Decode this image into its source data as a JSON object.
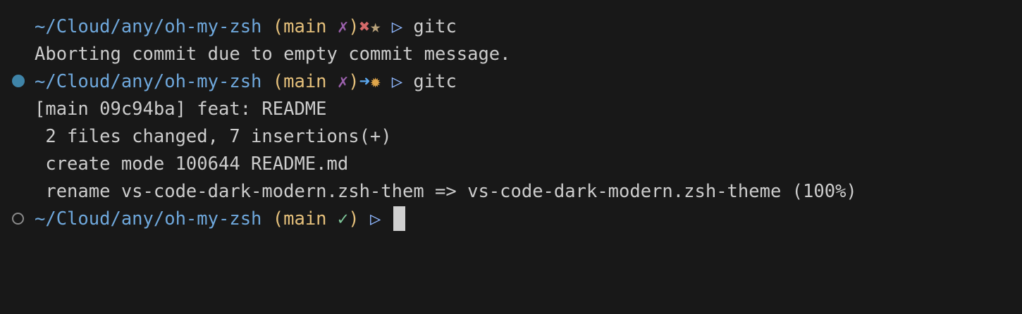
{
  "prompt": {
    "path": "~/Cloud/any/oh-my-zsh",
    "branch": "main",
    "dirty_mark": "✗",
    "clean_mark": "✓",
    "prompt_char": "▷"
  },
  "lines": [
    {
      "type": "prompt",
      "status": [
        "✖",
        "★"
      ],
      "command": "gitc"
    },
    {
      "type": "output",
      "text": "Aborting commit due to empty commit message."
    },
    {
      "type": "prompt",
      "status": [
        "➜",
        "✹"
      ],
      "command": "gitc"
    },
    {
      "type": "output",
      "text": "[main 09c94ba] feat: README"
    },
    {
      "type": "output",
      "text": " 2 files changed, 7 insertions(+)"
    },
    {
      "type": "output",
      "text": " create mode 100644 README.md"
    },
    {
      "type": "output",
      "text": " rename vs-code-dark-modern.zsh-them => vs-code-dark-modern.zsh-theme (100%)"
    },
    {
      "type": "prompt",
      "status": [],
      "command": ""
    }
  ],
  "colors": {
    "background": "#181818",
    "path": "#6fa8dc",
    "branch": "#e5c07b",
    "clean": "#7ec699",
    "error": "#d46a6a",
    "accent": "#5ba8f0"
  }
}
